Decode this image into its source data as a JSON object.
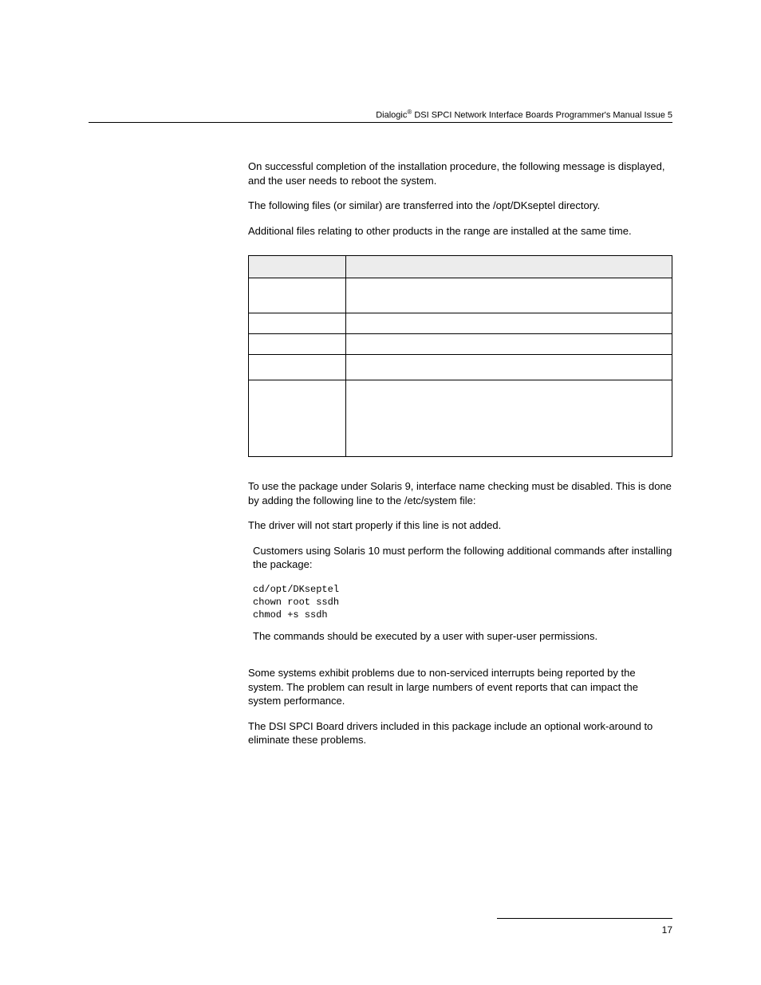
{
  "header": {
    "brand": "Dialogic",
    "title_rest": " DSI SPCI Network Interface Boards Programmer's Manual Issue 5"
  },
  "paras": {
    "p1": "On successful completion of the installation procedure, the following message is displayed, and the user needs to reboot the system.",
    "p2": "The following files (or similar) are transferred into the /opt/DKseptel directory.",
    "p3": "Additional files relating to other products in the range are installed at the same time.",
    "p4": "To use the package under Solaris 9, interface name checking must be disabled. This is done by adding the following line to the /etc/system file:",
    "p5": "The driver will not start properly if this line is not added.",
    "p6": "Customers using Solaris 10 must perform the following additional commands after installing the package:",
    "p7": "The commands should be executed by a user with super-user permissions.",
    "p8": "Some systems exhibit problems due to non-serviced interrupts being reported by the system. The problem can result in large numbers of event reports that can impact the system performance.",
    "p9": "The DSI SPCI Board drivers included in this package include an optional work-around to eliminate these problems."
  },
  "table": {
    "headers": [
      "",
      ""
    ],
    "rows": [
      [
        "",
        ""
      ],
      [
        "",
        ""
      ],
      [
        "",
        ""
      ],
      [
        "",
        ""
      ],
      [
        "",
        ""
      ]
    ]
  },
  "commands": "cd/opt/DKseptel\nchown root ssdh\nchmod +s ssdh",
  "page_number": "17"
}
